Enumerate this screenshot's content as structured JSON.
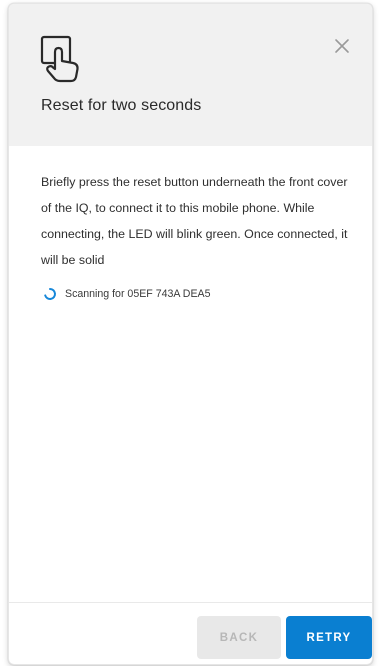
{
  "dialog": {
    "title": "Reset for two seconds",
    "description": "Briefly press the reset button underneath the front cover of the IQ, to connect it to this mobile phone. While connecting, the LED will blink green. Once connected, it will be solid",
    "status_text": "Scanning for 05EF 743A DEA5",
    "header_icon": "hand-press-icon",
    "close_icon": "close-icon",
    "status_icon": "loading-spinner-icon"
  },
  "buttons": {
    "back_label": "BACK",
    "retry_label": "RETRY"
  },
  "colors": {
    "accent": "#0a7fd1",
    "header_background": "#f1f1f1",
    "disabled_button": "#e8e8e8"
  }
}
